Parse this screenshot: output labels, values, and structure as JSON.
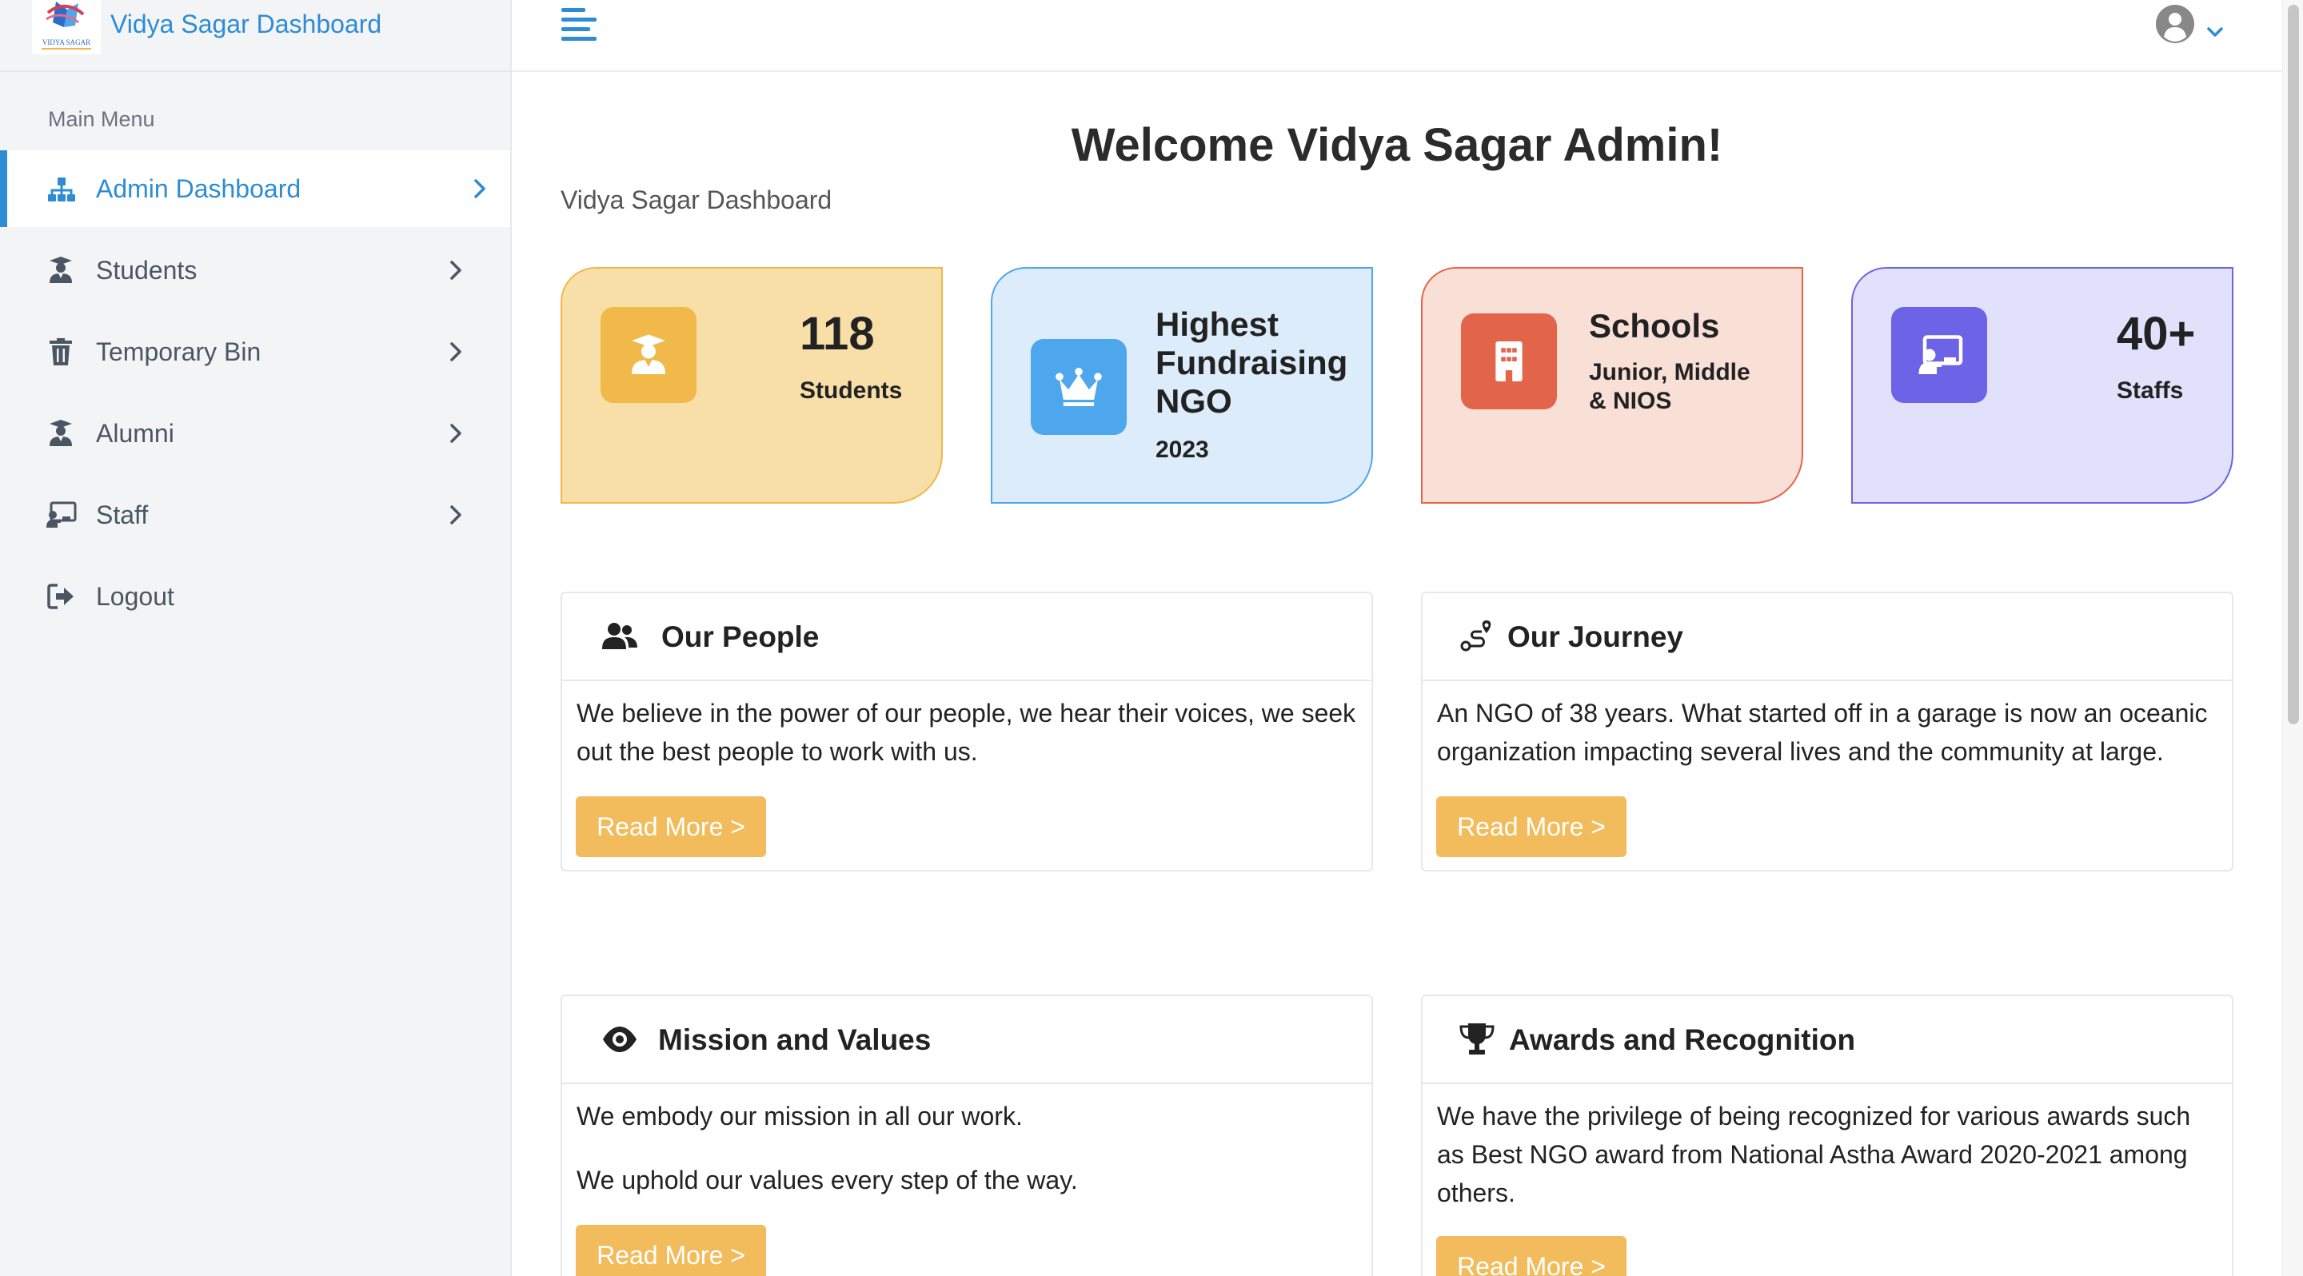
{
  "brand": {
    "title": "Vidya Sagar Dashboard",
    "logo_caption": "VIDYA SAGAR"
  },
  "sidebar": {
    "caption": "Main Menu",
    "items": [
      {
        "label": "Admin Dashboard",
        "icon": "sitemap-icon",
        "active": true
      },
      {
        "label": "Students",
        "icon": "graduate-icon"
      },
      {
        "label": "Temporary Bin",
        "icon": "trash-icon"
      },
      {
        "label": "Alumni",
        "icon": "graduate-icon"
      },
      {
        "label": "Staff",
        "icon": "chalkboard-teacher-icon"
      },
      {
        "label": "Logout",
        "icon": "logout-icon"
      }
    ]
  },
  "header": {
    "menu_icon": "hamburger-icon",
    "user_icon": "user-circle-icon"
  },
  "main": {
    "welcome": "Welcome Vidya Sagar Admin!",
    "subtitle": "Vidya Sagar Dashboard",
    "stats": [
      {
        "value": "118",
        "label": "Students",
        "icon": "graduate-icon",
        "color": "#f1b84a"
      },
      {
        "title_lines": [
          "Highest",
          "Fundraising",
          "NGO"
        ],
        "label": "2023",
        "icon": "crown-icon",
        "color": "#4ea6ec"
      },
      {
        "title": "Schools",
        "label_lines": [
          "Junior, Middle",
          "& NIOS"
        ],
        "icon": "building-icon",
        "color": "#e2654a"
      },
      {
        "value": "40+",
        "label": "Staffs",
        "icon": "chalkboard-teacher-icon",
        "color": "#6c63e6"
      }
    ],
    "cards": [
      {
        "title": "Our People",
        "icon": "users-icon",
        "text": "We believe in the power of our people, we hear their voices, we seek out the best people to work with us.",
        "button": "Read More >"
      },
      {
        "title": "Our Journey",
        "icon": "route-icon",
        "text": "An NGO of 38 years. What started off in a garage is now an oceanic organization impacting several lives and the community at large.",
        "button": "Read More >"
      },
      {
        "title": "Mission and Values",
        "icon": "eye-icon",
        "paragraphs": [
          "We embody our mission in all our work.",
          "We uphold our values every step of the way."
        ],
        "button": "Read More >"
      },
      {
        "title": "Awards and Recognition",
        "icon": "trophy-icon",
        "text": "We have the privilege of being recognized for various awards such as Best NGO award from National Astha Award 2020-2021 among others.",
        "button": "Read More >"
      }
    ]
  },
  "colors": {
    "accent": "#2d8cd4",
    "button": "#f2bc5c"
  }
}
